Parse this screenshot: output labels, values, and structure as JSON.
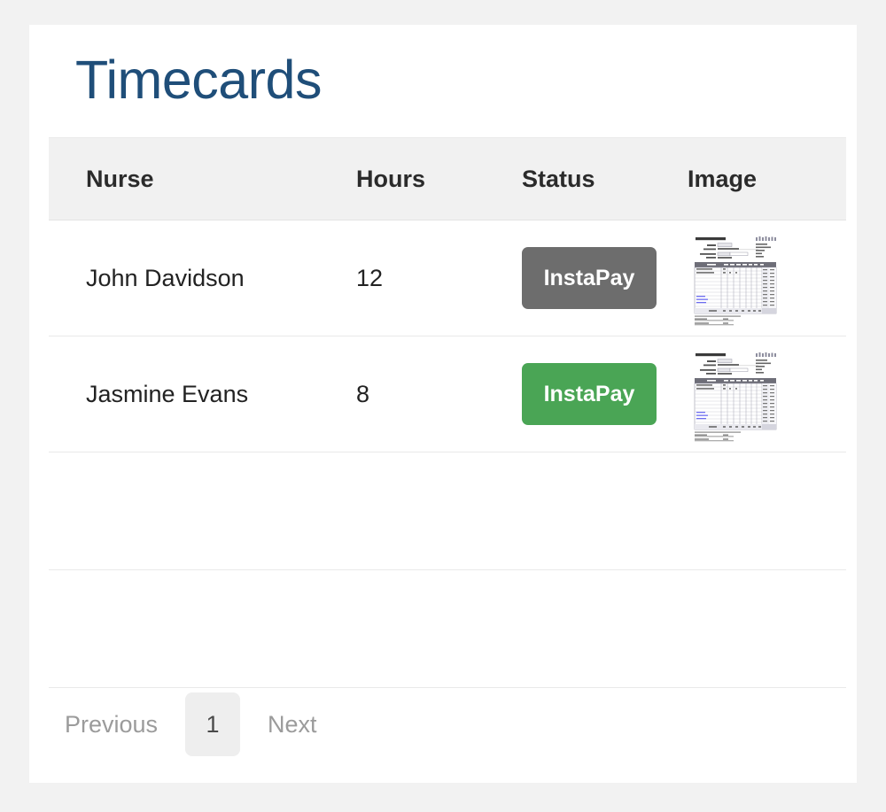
{
  "page": {
    "title": "Timecards"
  },
  "table": {
    "columns": [
      {
        "key": "nurse",
        "label": "Nurse"
      },
      {
        "key": "hours",
        "label": "Hours"
      },
      {
        "key": "status",
        "label": "Status"
      },
      {
        "key": "image",
        "label": "Image"
      }
    ],
    "rows": [
      {
        "nurse": "John Davidson",
        "hours": "12",
        "status_label": "InstaPay",
        "status_color": "#6d6d6d",
        "status_state": "pending",
        "image": "timesheet-thumbnail"
      },
      {
        "nurse": "Jasmine Evans",
        "hours": "8",
        "status_label": "InstaPay",
        "status_color": "#4aa555",
        "status_state": "paid",
        "image": "timesheet-thumbnail"
      }
    ],
    "empty_rows": 2
  },
  "pagination": {
    "previous_label": "Previous",
    "next_label": "Next",
    "current_page": "1"
  },
  "colors": {
    "title": "#1f4e79",
    "page_background": "#f2f2f2",
    "card_background": "#ffffff",
    "header_background": "#f1f1f1",
    "row_border": "#e9e9e9",
    "status_pending": "#6d6d6d",
    "status_paid": "#4aa555",
    "pagination_link": "#9b9b9b",
    "pagination_active_background": "#eeeeee"
  }
}
